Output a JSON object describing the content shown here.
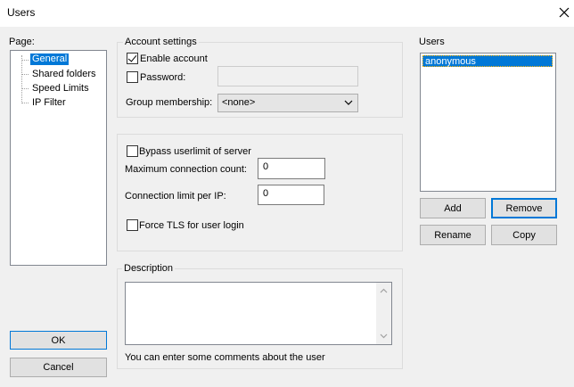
{
  "window": {
    "title": "Users"
  },
  "page_tree": {
    "label": "Page:",
    "items": [
      "General",
      "Shared folders",
      "Speed Limits",
      "IP Filter"
    ],
    "selected": "General"
  },
  "account_settings": {
    "legend": "Account settings",
    "enable_account": {
      "label": "Enable account",
      "checked": true
    },
    "password": {
      "label": "Password:",
      "checked": false,
      "value": ""
    },
    "group_membership": {
      "label": "Group membership:",
      "value": "<none>"
    }
  },
  "limits": {
    "bypass": {
      "label": "Bypass userlimit of server",
      "checked": false
    },
    "max_connection": {
      "label": "Maximum connection count:",
      "value": "0"
    },
    "per_ip": {
      "label": "Connection limit per IP:",
      "value": "0"
    },
    "force_tls": {
      "label": "Force TLS for user login",
      "checked": false
    }
  },
  "description": {
    "legend": "Description",
    "value": "",
    "hint": "You can enter some comments about the user"
  },
  "users": {
    "legend": "Users",
    "items": [
      "anonymous"
    ],
    "selected": "anonymous",
    "buttons": {
      "add": "Add",
      "remove": "Remove",
      "rename": "Rename",
      "copy": "Copy"
    }
  },
  "dialog_buttons": {
    "ok": "OK",
    "cancel": "Cancel"
  },
  "icons": {
    "close": "close-icon",
    "dropdown": "chevron-down-icon",
    "check": "checkmark-icon"
  },
  "colors": {
    "selection": "#0078d7",
    "background": "#f0f0f0"
  }
}
